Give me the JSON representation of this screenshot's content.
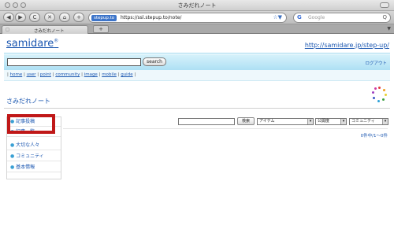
{
  "window": {
    "title": "さみだれノート",
    "nav": {
      "back_icon": "◀",
      "forward_icon": "▶",
      "reload_icon": "C",
      "stop_icon": "✕",
      "home_icon": "⌂",
      "add_icon": "+"
    },
    "url": {
      "badge": "stepup.to",
      "value": "https://ssl.stepup.to/note/",
      "star_icon": "☆▼"
    },
    "search": {
      "engine_icon": "G",
      "placeholder": "Google",
      "icon": "Q"
    },
    "tab": {
      "close_icon": "◻",
      "title": "さみだれノート"
    },
    "tab_add": "+",
    "tab_menu": "▼"
  },
  "site": {
    "brand": "samidare",
    "brand_mark": "®",
    "url_link": "http://samidare.jp/step-up/",
    "search_button": "search",
    "logout": "ログアウト",
    "links": [
      "home",
      "user",
      "point",
      "community",
      "image",
      "mobile",
      "guide"
    ]
  },
  "main": {
    "title": "さみだれノート",
    "sidebar": [
      {
        "label": "記事投稿"
      },
      {
        "label": "記事一覧"
      },
      {
        "label": "大切な人々"
      },
      {
        "label": "コミュニティ"
      },
      {
        "label": "基本情報"
      }
    ],
    "filter": {
      "search_button": "検索",
      "item_select": "アイテム",
      "visibility_select": "公開度",
      "community_select": "コミュニティ"
    },
    "count": "0件中/1～0件"
  },
  "colors": {
    "link": "#1a56b0",
    "highlight": "#c01818",
    "band_start": "#d7f2fb",
    "band_end": "#aee0f4"
  }
}
